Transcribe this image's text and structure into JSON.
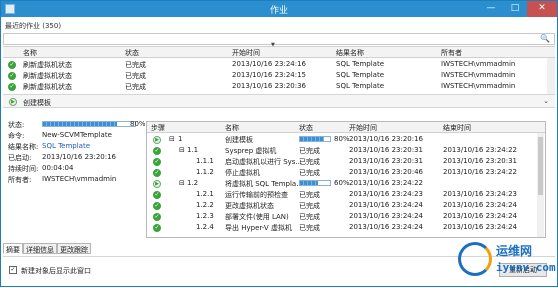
{
  "window": {
    "title": "作业",
    "min_label": "—",
    "max_label": "□",
    "close_label": "✕"
  },
  "recent_jobs": {
    "label": "最近的作业 (350)",
    "search_icon": "🔍",
    "columns": {
      "name": "名称",
      "status": "状态",
      "start_time": "开始时间",
      "result_name": "结果名称",
      "owner": "所有者"
    },
    "rows": [
      {
        "name": "刷新虚拟机状态",
        "status": "已完成",
        "start_time": "2013/10/16 23:24:16",
        "result_name": "SQL Template",
        "owner": "IWSTECH\\vmmadmin"
      },
      {
        "name": "刷新虚拟机状态",
        "status": "已完成",
        "start_time": "2013/10/16 23:24:15",
        "result_name": "SQL Template",
        "owner": "IWSTECH\\vmmadmin"
      },
      {
        "name": "刷新虚拟机状态",
        "status": "已完成",
        "start_time": "2013/10/16 23:20:36",
        "result_name": "SQL Template",
        "owner": "IWSTECH\\vmmadmin"
      }
    ]
  },
  "current_job": {
    "title": "创建模板",
    "chevron": "⌄"
  },
  "summary": {
    "status_label": "状态:",
    "status_progress": 0.8,
    "status_percent_text": "80%",
    "command_label": "命令:",
    "command_value": "New-SCVMTemplate",
    "result_label": "结果名称:",
    "result_value": "SQL Template",
    "started_label": "已启动:",
    "started_value": "2013/10/16 23:20:16",
    "duration_label": "持续时间:",
    "duration_value": "00:04:04",
    "owner_label": "所有者:",
    "owner_value": "IWSTECH\\vmmadmin"
  },
  "steps": {
    "columns": {
      "step": "步骤",
      "name": "名称",
      "status": "状态",
      "start_time": "开始时间",
      "end_time": "结束时间"
    },
    "rows": [
      {
        "icon": "running",
        "expander": "⊟",
        "step": "1",
        "name": "创建模板",
        "status_progress": 0.8,
        "status_text": "80%",
        "start_time": "2013/10/16 23:20:16",
        "end_time": ""
      },
      {
        "icon": "ok",
        "expander": "⊟",
        "step": "1.1",
        "name": "Sysprep 虚拟机",
        "status_progress": null,
        "status_text": "已完成",
        "start_time": "2013/10/16 23:20:31",
        "end_time": "2013/10/16 23:24:22"
      },
      {
        "icon": "ok",
        "expander": "",
        "step": "1.1.1",
        "name": "启动虚拟机以进行 Sys...",
        "status_progress": null,
        "status_text": "已完成",
        "start_time": "2013/10/16 23:20:31",
        "end_time": "2013/10/16 23:20:31"
      },
      {
        "icon": "ok",
        "expander": "",
        "step": "1.1.2",
        "name": "停止虚拟机",
        "status_progress": null,
        "status_text": "已完成",
        "start_time": "2013/10/16 23:20:46",
        "end_time": "2013/10/16 23:24:22"
      },
      {
        "icon": "running",
        "expander": "⊟",
        "step": "1.2",
        "name": "将虚拟机 SQL Templa...",
        "status_progress": 0.6,
        "status_text": "60%",
        "start_time": "2013/10/16 23:24:22",
        "end_time": ""
      },
      {
        "icon": "ok",
        "expander": "",
        "step": "1.2.1",
        "name": "运行传输前的预检查",
        "status_progress": null,
        "status_text": "已完成",
        "start_time": "2013/10/16 23:24:23",
        "end_time": "2013/10/16 23:24:23"
      },
      {
        "icon": "ok",
        "expander": "",
        "step": "1.2.2",
        "name": "更改虚拟机状态",
        "status_progress": null,
        "status_text": "已完成",
        "start_time": "2013/10/16 23:24:24",
        "end_time": "2013/10/16 23:24:24"
      },
      {
        "icon": "ok",
        "expander": "",
        "step": "1.2.3",
        "name": "部署文件(使用 LAN)",
        "status_progress": null,
        "status_text": "已完成",
        "start_time": "2013/10/16 23:24:24",
        "end_time": "2013/10/16 23:24:24"
      },
      {
        "icon": "ok",
        "expander": "",
        "step": "1.2.4",
        "name": "导出 Hyper-V 虚拟机",
        "status_progress": null,
        "status_text": "已完成",
        "start_time": "2013/10/16 23:24:24",
        "end_time": "2013/10/16 23:24:24"
      }
    ]
  },
  "tabs": [
    {
      "label": "摘要",
      "active": true
    },
    {
      "label": "详细信息",
      "active": false
    },
    {
      "label": "更改跟踪",
      "active": false
    }
  ],
  "footer": {
    "checkbox_label": "新建对象后显示此窗口",
    "checkbox_checked": true,
    "close_button": "重新启动"
  },
  "watermark": {
    "line1": "运维网",
    "line2": "iyunv.com"
  },
  "colors": {
    "titlebar": "#2b8fcf",
    "success": "#3aa33a",
    "link": "#1a5fb4",
    "progress": "#3a8fd6"
  }
}
